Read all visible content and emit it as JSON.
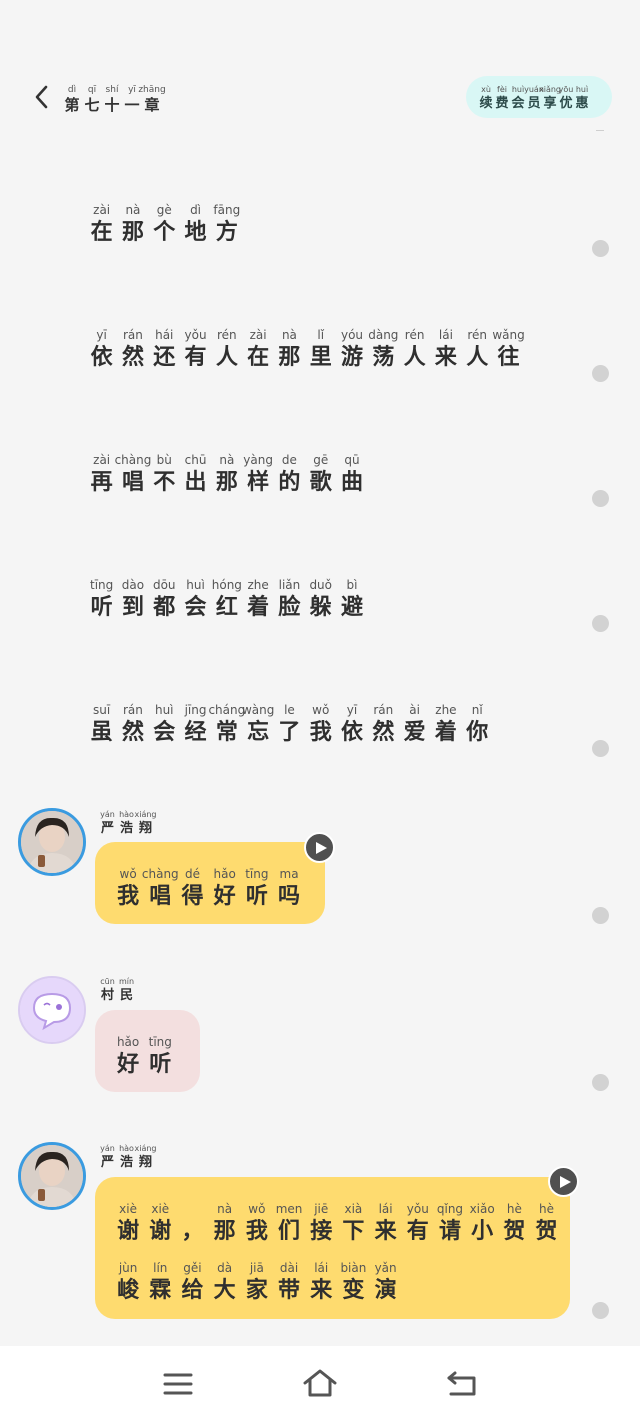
{
  "header": {
    "title": [
      [
        "dì",
        "第"
      ],
      [
        "qī",
        "七"
      ],
      [
        "shí",
        "十"
      ],
      [
        "yī",
        "一"
      ],
      [
        "zhāng",
        "章"
      ]
    ],
    "vip_button": [
      [
        "xù",
        "续"
      ],
      [
        "fèi",
        "费"
      ],
      [
        "huì",
        "会"
      ],
      [
        "yuán",
        "员"
      ],
      [
        "xiǎng",
        "享"
      ],
      [
        "yōu",
        "优"
      ],
      [
        "huì",
        "惠"
      ]
    ]
  },
  "narration": [
    [
      [
        "zài",
        "在"
      ],
      [
        "nà",
        "那"
      ],
      [
        "gè",
        "个"
      ],
      [
        "dì",
        "地"
      ],
      [
        "fāng",
        "方"
      ]
    ],
    [
      [
        "yī",
        "依"
      ],
      [
        "rán",
        "然"
      ],
      [
        "hái",
        "还"
      ],
      [
        "yǒu",
        "有"
      ],
      [
        "rén",
        "人"
      ],
      [
        "zài",
        "在"
      ],
      [
        "nà",
        "那"
      ],
      [
        "lǐ",
        "里"
      ],
      [
        "yóu",
        "游"
      ],
      [
        "dàng",
        "荡"
      ],
      [
        "rén",
        "人"
      ],
      [
        "lái",
        "来"
      ],
      [
        "rén",
        "人"
      ],
      [
        "wǎng",
        "往"
      ]
    ],
    [
      [
        "zài",
        "再"
      ],
      [
        "chàng",
        "唱"
      ],
      [
        "bù",
        "不"
      ],
      [
        "chū",
        "出"
      ],
      [
        "nà",
        "那"
      ],
      [
        "yàng",
        "样"
      ],
      [
        "de",
        "的"
      ],
      [
        "gē",
        "歌"
      ],
      [
        "qū",
        "曲"
      ]
    ],
    [
      [
        "tīng",
        "听"
      ],
      [
        "dào",
        "到"
      ],
      [
        "dōu",
        "都"
      ],
      [
        "huì",
        "会"
      ],
      [
        "hóng",
        "红"
      ],
      [
        "zhe",
        "着"
      ],
      [
        "liǎn",
        "脸"
      ],
      [
        "duǒ",
        "躲"
      ],
      [
        "bì",
        "避"
      ]
    ],
    [
      [
        "suī",
        "虽"
      ],
      [
        "rán",
        "然"
      ],
      [
        "huì",
        "会"
      ],
      [
        "jīng",
        "经"
      ],
      [
        "cháng",
        "常"
      ],
      [
        "wàng",
        "忘"
      ],
      [
        "le",
        "了"
      ],
      [
        "wǒ",
        "我"
      ],
      [
        "yī",
        "依"
      ],
      [
        "rán",
        "然"
      ],
      [
        "ài",
        "爱"
      ],
      [
        "zhe",
        "着"
      ],
      [
        "nǐ",
        "你"
      ]
    ]
  ],
  "messages": [
    {
      "speaker": [
        [
          "yán",
          "严"
        ],
        [
          "hào",
          "浩"
        ],
        [
          "xiáng",
          "翔"
        ]
      ],
      "lines": [
        [
          [
            "wǒ",
            "我"
          ],
          [
            "chàng",
            "唱"
          ],
          [
            "dé",
            "得"
          ],
          [
            "hǎo",
            "好"
          ],
          [
            "tīng",
            "听"
          ],
          [
            "ma",
            "吗"
          ]
        ]
      ]
    },
    {
      "speaker": [
        [
          "cūn",
          "村"
        ],
        [
          "mín",
          "民"
        ]
      ],
      "lines": [
        [
          [
            "hǎo",
            "好"
          ],
          [
            "tīng",
            "听"
          ]
        ]
      ]
    },
    {
      "speaker": [
        [
          "yán",
          "严"
        ],
        [
          "hào",
          "浩"
        ],
        [
          "xiáng",
          "翔"
        ]
      ],
      "lines": [
        [
          [
            "xiè",
            "谢"
          ],
          [
            "xiè",
            "谢"
          ],
          [
            "",
            "，"
          ],
          [
            "nà",
            "那"
          ],
          [
            "wǒ",
            "我"
          ],
          [
            "men",
            "们"
          ],
          [
            "jiē",
            "接"
          ],
          [
            "xià",
            "下"
          ],
          [
            "lái",
            "来"
          ],
          [
            "yǒu",
            "有"
          ],
          [
            "qǐng",
            "请"
          ],
          [
            "xiǎo",
            "小"
          ],
          [
            "hè",
            "贺"
          ],
          [
            "hè",
            "贺"
          ]
        ],
        [
          [
            "jùn",
            "峻"
          ],
          [
            "lín",
            "霖"
          ],
          [
            "gěi",
            "给"
          ],
          [
            "dà",
            "大"
          ],
          [
            "jiā",
            "家"
          ],
          [
            "dài",
            "带"
          ],
          [
            "lái",
            "来"
          ],
          [
            "biàn",
            "变"
          ],
          [
            "yǎn",
            "演"
          ]
        ]
      ]
    }
  ],
  "icons": {
    "back": "chevron-left-icon",
    "play": "play-icon",
    "avatar_villager": "ghost-chat-icon",
    "nav_menu": "menu-icon",
    "nav_home": "home-icon",
    "nav_back": "return-icon"
  },
  "colors": {
    "background": "#f5f5f5",
    "bubble_hero": "#fedb6f",
    "bubble_villager": "#f3dfdf",
    "vip_button": "#d9f7f5",
    "avatar_ring": "#3a9be0"
  }
}
